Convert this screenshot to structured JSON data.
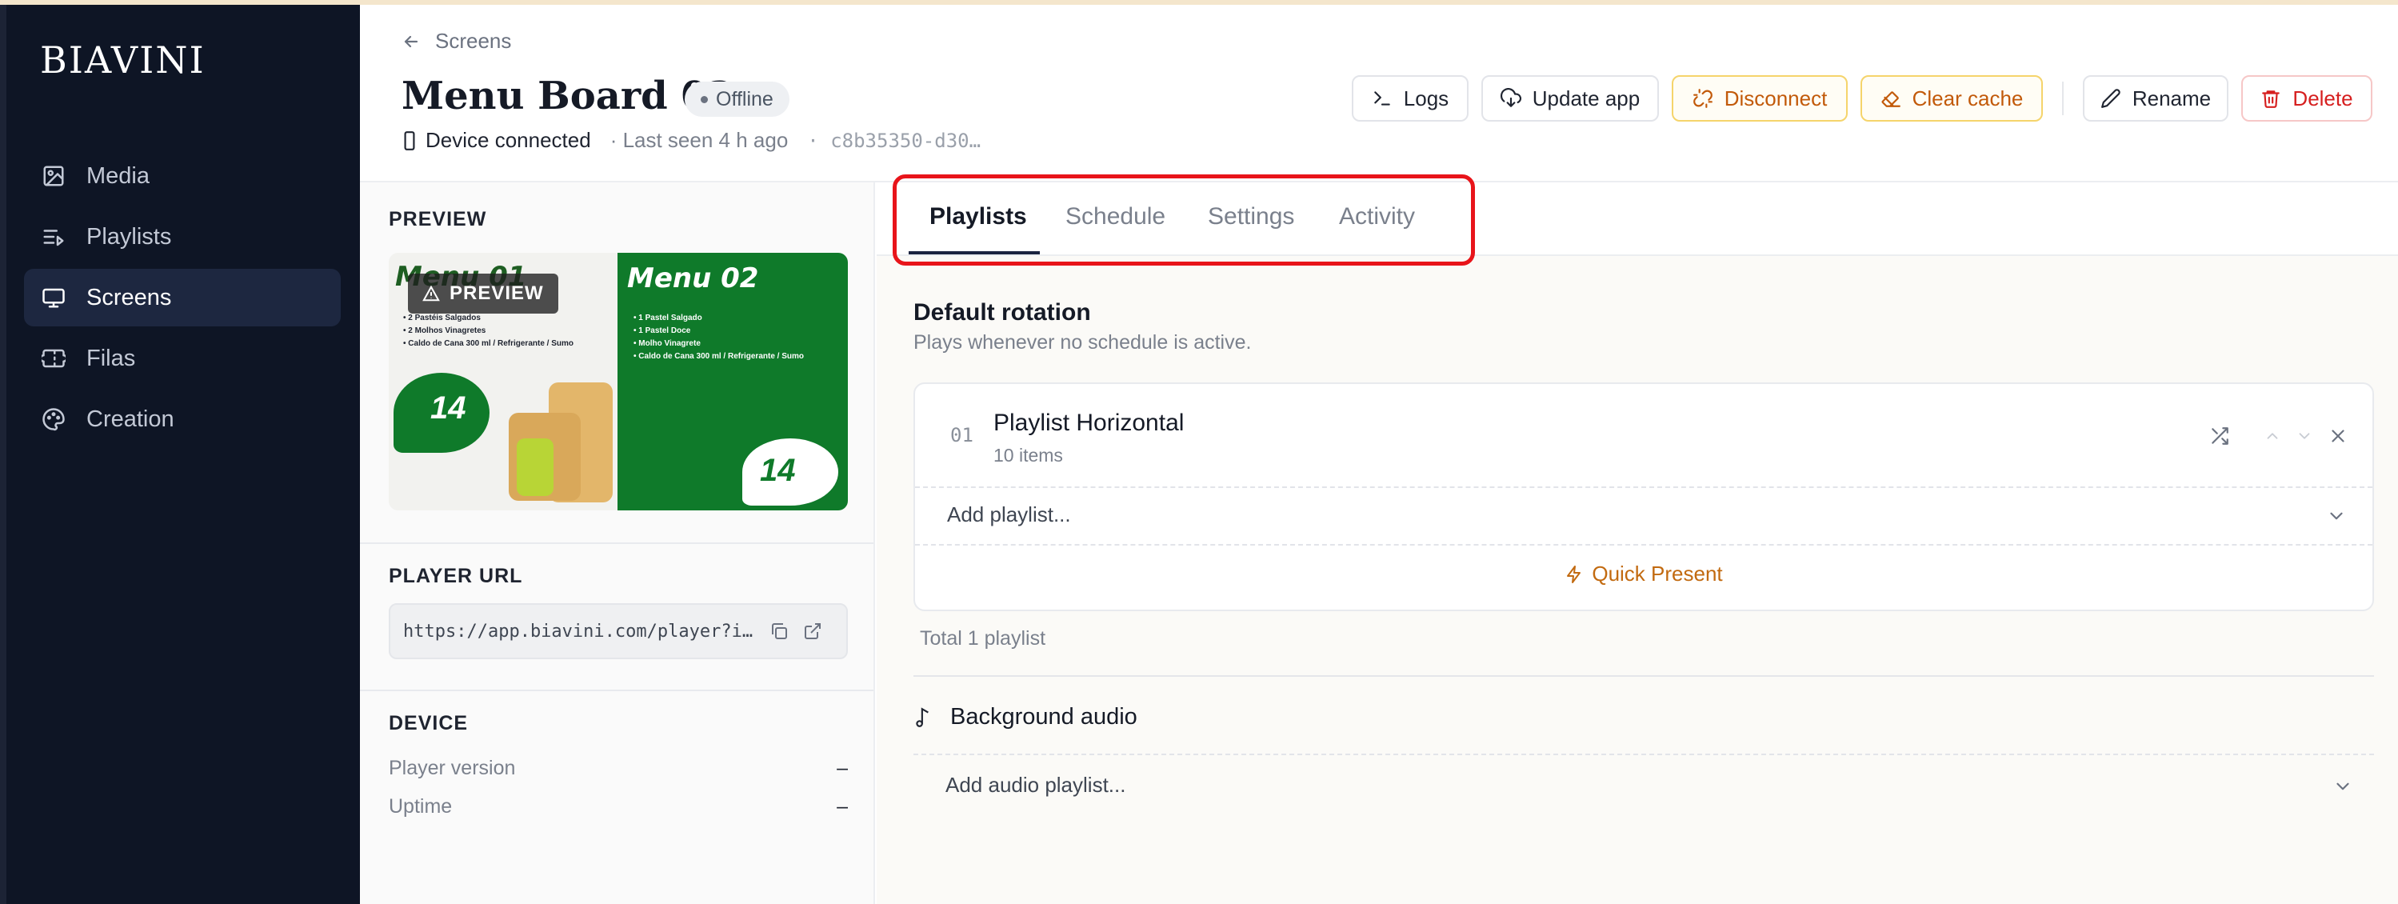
{
  "app": {
    "logo": "BIAVINI"
  },
  "sidebar": {
    "items": [
      {
        "label": "Media",
        "icon": "image-icon"
      },
      {
        "label": "Playlists",
        "icon": "playlist-icon"
      },
      {
        "label": "Screens",
        "icon": "monitor-icon",
        "active": true
      },
      {
        "label": "Filas",
        "icon": "ticket-icon"
      },
      {
        "label": "Creation",
        "icon": "palette-icon"
      }
    ]
  },
  "header": {
    "breadcrumb": "Screens",
    "title": "Menu Board 02",
    "status": "Offline",
    "device_status": "Device connected",
    "last_seen": "· Last seen 4 h ago",
    "device_id": "· c8b35350-d30…"
  },
  "toolbar": {
    "logs": "Logs",
    "update_app": "Update app",
    "disconnect": "Disconnect",
    "clear_cache": "Clear cache",
    "rename": "Rename",
    "delete": "Delete"
  },
  "left": {
    "preview_title": "PREVIEW",
    "preview_badge": "PREVIEW",
    "preview_image": {
      "left_heading": "Menu 01",
      "left_lines": [
        "• 2 Pastéis Salgados",
        "• 2 Molhos Vinagretes",
        "• Caldo de Cana 300 ml / Refrigerante / Sumo"
      ],
      "left_price": "14",
      "right_heading": "Menu 02",
      "right_lines": [
        "• 1 Pastel Salgado",
        "• 1 Pastel Doce",
        "• Molho Vinagrete",
        "• Caldo de Cana 300 ml / Refrigerante / Sumo"
      ],
      "right_price": "14"
    },
    "player_url_title": "PLAYER URL",
    "player_url": "https://app.biavini.com/player?i…",
    "device_title": "DEVICE",
    "device": [
      {
        "label": "Player version",
        "value": "–"
      },
      {
        "label": "Uptime",
        "value": "–"
      }
    ]
  },
  "tabs": [
    {
      "label": "Playlists",
      "active": true
    },
    {
      "label": "Schedule"
    },
    {
      "label": "Settings"
    },
    {
      "label": "Activity"
    }
  ],
  "default_rotation": {
    "title": "Default rotation",
    "subtitle": "Plays whenever no schedule is active.",
    "items": [
      {
        "index": "01",
        "name": "Playlist Horizontal",
        "count": "10 items"
      }
    ],
    "add_placeholder": "Add playlist...",
    "quick_present": "Quick Present",
    "total": "Total 1 playlist"
  },
  "background_audio": {
    "title": "Background audio",
    "add_placeholder": "Add audio playlist..."
  },
  "colors": {
    "sidebar_bg": "#0e1525",
    "accent_warn": "#c25a0a",
    "danger": "#d61f1f",
    "highlight": "#e8141a"
  }
}
